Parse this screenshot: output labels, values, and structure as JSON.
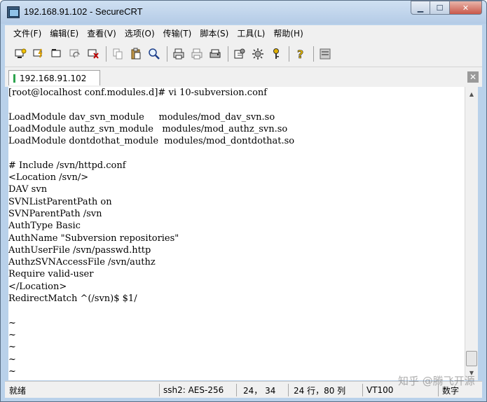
{
  "window": {
    "title": "192.168.91.102 - SecureCRT",
    "buttons": {
      "minimize": "▁",
      "maximize": "☐",
      "close": "✕"
    }
  },
  "menu": [
    "文件(F)",
    "编辑(E)",
    "查看(V)",
    "选项(O)",
    "传输(T)",
    "脚本(S)",
    "工具(L)",
    "帮助(H)"
  ],
  "toolbar": {
    "icons": [
      "connect-icon",
      "quick-connect-icon",
      "connect-tab-icon",
      "reconnect-icon",
      "disconnect-icon",
      "copy-icon",
      "paste-icon",
      "find-icon",
      "print-icon",
      "print-selection-icon",
      "printer-setup-icon",
      "session-options-icon",
      "global-options-icon",
      "keymap-icon",
      "help-icon",
      "sftp-icon"
    ]
  },
  "tab": {
    "label": "192.168.91.102",
    "status_color": "#2ea44f",
    "close": "✕"
  },
  "terminal": {
    "lines": [
      "[root@localhost conf.modules.d]# vi 10-subversion.conf",
      "",
      "LoadModule dav_svn_module     modules/mod_dav_svn.so",
      "LoadModule authz_svn_module   modules/mod_authz_svn.so",
      "LoadModule dontdothat_module  modules/mod_dontdothat.so",
      "",
      "# Include /svn/httpd.conf",
      "<Location /svn/>",
      "DAV svn",
      "SVNListParentPath on",
      "SVNParentPath /svn",
      "AuthType Basic",
      "AuthName \"Subversion repositories\"",
      "AuthUserFile /svn/passwd.http",
      "AuthzSVNAccessFile /svn/authz",
      "Require valid-user",
      "</Location>",
      "RedirectMatch ^(/svn)$ $1/",
      "",
      "~",
      "~",
      "~",
      "~",
      "~"
    ]
  },
  "statusbar": {
    "ready": "就绪",
    "protocol": "ssh2: AES-256",
    "cursor": "24， 34",
    "size": "24 行，80 列",
    "terminal_type": "VT100",
    "numlock": "数字"
  },
  "watermark": "知乎 @腾飞开源"
}
